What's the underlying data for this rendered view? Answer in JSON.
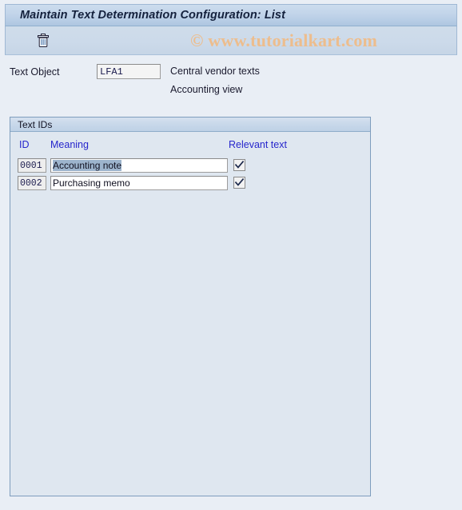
{
  "window": {
    "title": "Maintain Text Determination Configuration: List"
  },
  "toolbar": {
    "delete_icon": "trash-icon",
    "watermark": "© www.tutorialkart.com"
  },
  "header_fields": {
    "text_object_label": "Text Object",
    "text_object_value": "LFA1",
    "description_line_1": "Central vendor texts",
    "description_line_2": "Accounting view"
  },
  "groupbox": {
    "title": "Text IDs",
    "columns": {
      "id": "ID",
      "meaning": "Meaning",
      "relevant": "Relevant text"
    },
    "rows": [
      {
        "id": "0001",
        "meaning": "Accounting note",
        "relevant": true,
        "selected": true
      },
      {
        "id": "0002",
        "meaning": "Purchasing memo",
        "relevant": true,
        "selected": false
      }
    ]
  },
  "colors": {
    "page_background": "#e9eef5",
    "title_bar": "#c3d5ea",
    "groupbox_background": "#dfe7f0",
    "groupbox_border": "#7e9dbd",
    "column_header_text": "#2626cc",
    "watermark_text": "#edbd8d",
    "selection_highlight": "#9db4cd"
  }
}
